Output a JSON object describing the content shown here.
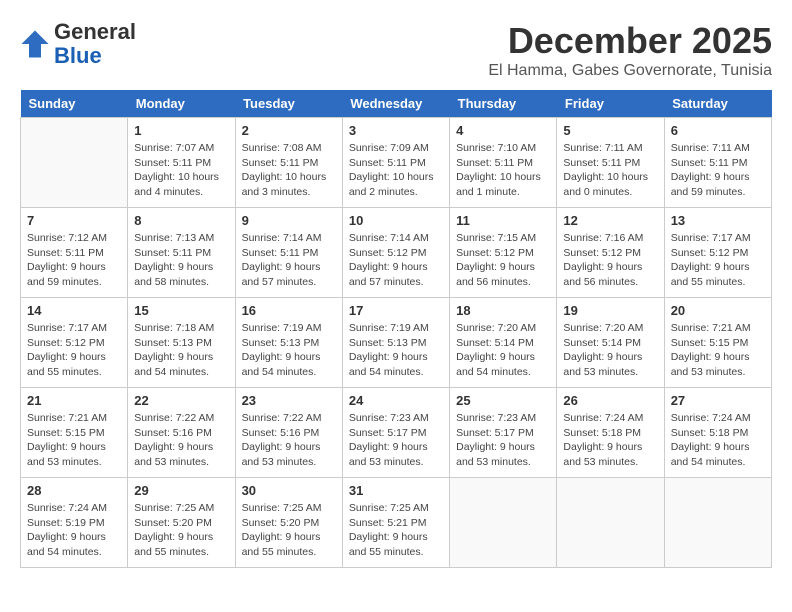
{
  "logo": {
    "line1": "General",
    "line2": "Blue"
  },
  "title": "December 2025",
  "subtitle": "El Hamma, Gabes Governorate, Tunisia",
  "days_header": [
    "Sunday",
    "Monday",
    "Tuesday",
    "Wednesday",
    "Thursday",
    "Friday",
    "Saturday"
  ],
  "weeks": [
    [
      {
        "num": "",
        "sunrise": "",
        "sunset": "",
        "daylight": ""
      },
      {
        "num": "1",
        "sunrise": "Sunrise: 7:07 AM",
        "sunset": "Sunset: 5:11 PM",
        "daylight": "Daylight: 10 hours and 4 minutes."
      },
      {
        "num": "2",
        "sunrise": "Sunrise: 7:08 AM",
        "sunset": "Sunset: 5:11 PM",
        "daylight": "Daylight: 10 hours and 3 minutes."
      },
      {
        "num": "3",
        "sunrise": "Sunrise: 7:09 AM",
        "sunset": "Sunset: 5:11 PM",
        "daylight": "Daylight: 10 hours and 2 minutes."
      },
      {
        "num": "4",
        "sunrise": "Sunrise: 7:10 AM",
        "sunset": "Sunset: 5:11 PM",
        "daylight": "Daylight: 10 hours and 1 minute."
      },
      {
        "num": "5",
        "sunrise": "Sunrise: 7:11 AM",
        "sunset": "Sunset: 5:11 PM",
        "daylight": "Daylight: 10 hours and 0 minutes."
      },
      {
        "num": "6",
        "sunrise": "Sunrise: 7:11 AM",
        "sunset": "Sunset: 5:11 PM",
        "daylight": "Daylight: 9 hours and 59 minutes."
      }
    ],
    [
      {
        "num": "7",
        "sunrise": "Sunrise: 7:12 AM",
        "sunset": "Sunset: 5:11 PM",
        "daylight": "Daylight: 9 hours and 59 minutes."
      },
      {
        "num": "8",
        "sunrise": "Sunrise: 7:13 AM",
        "sunset": "Sunset: 5:11 PM",
        "daylight": "Daylight: 9 hours and 58 minutes."
      },
      {
        "num": "9",
        "sunrise": "Sunrise: 7:14 AM",
        "sunset": "Sunset: 5:11 PM",
        "daylight": "Daylight: 9 hours and 57 minutes."
      },
      {
        "num": "10",
        "sunrise": "Sunrise: 7:14 AM",
        "sunset": "Sunset: 5:12 PM",
        "daylight": "Daylight: 9 hours and 57 minutes."
      },
      {
        "num": "11",
        "sunrise": "Sunrise: 7:15 AM",
        "sunset": "Sunset: 5:12 PM",
        "daylight": "Daylight: 9 hours and 56 minutes."
      },
      {
        "num": "12",
        "sunrise": "Sunrise: 7:16 AM",
        "sunset": "Sunset: 5:12 PM",
        "daylight": "Daylight: 9 hours and 56 minutes."
      },
      {
        "num": "13",
        "sunrise": "Sunrise: 7:17 AM",
        "sunset": "Sunset: 5:12 PM",
        "daylight": "Daylight: 9 hours and 55 minutes."
      }
    ],
    [
      {
        "num": "14",
        "sunrise": "Sunrise: 7:17 AM",
        "sunset": "Sunset: 5:12 PM",
        "daylight": "Daylight: 9 hours and 55 minutes."
      },
      {
        "num": "15",
        "sunrise": "Sunrise: 7:18 AM",
        "sunset": "Sunset: 5:13 PM",
        "daylight": "Daylight: 9 hours and 54 minutes."
      },
      {
        "num": "16",
        "sunrise": "Sunrise: 7:19 AM",
        "sunset": "Sunset: 5:13 PM",
        "daylight": "Daylight: 9 hours and 54 minutes."
      },
      {
        "num": "17",
        "sunrise": "Sunrise: 7:19 AM",
        "sunset": "Sunset: 5:13 PM",
        "daylight": "Daylight: 9 hours and 54 minutes."
      },
      {
        "num": "18",
        "sunrise": "Sunrise: 7:20 AM",
        "sunset": "Sunset: 5:14 PM",
        "daylight": "Daylight: 9 hours and 54 minutes."
      },
      {
        "num": "19",
        "sunrise": "Sunrise: 7:20 AM",
        "sunset": "Sunset: 5:14 PM",
        "daylight": "Daylight: 9 hours and 53 minutes."
      },
      {
        "num": "20",
        "sunrise": "Sunrise: 7:21 AM",
        "sunset": "Sunset: 5:15 PM",
        "daylight": "Daylight: 9 hours and 53 minutes."
      }
    ],
    [
      {
        "num": "21",
        "sunrise": "Sunrise: 7:21 AM",
        "sunset": "Sunset: 5:15 PM",
        "daylight": "Daylight: 9 hours and 53 minutes."
      },
      {
        "num": "22",
        "sunrise": "Sunrise: 7:22 AM",
        "sunset": "Sunset: 5:16 PM",
        "daylight": "Daylight: 9 hours and 53 minutes."
      },
      {
        "num": "23",
        "sunrise": "Sunrise: 7:22 AM",
        "sunset": "Sunset: 5:16 PM",
        "daylight": "Daylight: 9 hours and 53 minutes."
      },
      {
        "num": "24",
        "sunrise": "Sunrise: 7:23 AM",
        "sunset": "Sunset: 5:17 PM",
        "daylight": "Daylight: 9 hours and 53 minutes."
      },
      {
        "num": "25",
        "sunrise": "Sunrise: 7:23 AM",
        "sunset": "Sunset: 5:17 PM",
        "daylight": "Daylight: 9 hours and 53 minutes."
      },
      {
        "num": "26",
        "sunrise": "Sunrise: 7:24 AM",
        "sunset": "Sunset: 5:18 PM",
        "daylight": "Daylight: 9 hours and 53 minutes."
      },
      {
        "num": "27",
        "sunrise": "Sunrise: 7:24 AM",
        "sunset": "Sunset: 5:18 PM",
        "daylight": "Daylight: 9 hours and 54 minutes."
      }
    ],
    [
      {
        "num": "28",
        "sunrise": "Sunrise: 7:24 AM",
        "sunset": "Sunset: 5:19 PM",
        "daylight": "Daylight: 9 hours and 54 minutes."
      },
      {
        "num": "29",
        "sunrise": "Sunrise: 7:25 AM",
        "sunset": "Sunset: 5:20 PM",
        "daylight": "Daylight: 9 hours and 55 minutes."
      },
      {
        "num": "30",
        "sunrise": "Sunrise: 7:25 AM",
        "sunset": "Sunset: 5:20 PM",
        "daylight": "Daylight: 9 hours and 55 minutes."
      },
      {
        "num": "31",
        "sunrise": "Sunrise: 7:25 AM",
        "sunset": "Sunset: 5:21 PM",
        "daylight": "Daylight: 9 hours and 55 minutes."
      },
      {
        "num": "",
        "sunrise": "",
        "sunset": "",
        "daylight": ""
      },
      {
        "num": "",
        "sunrise": "",
        "sunset": "",
        "daylight": ""
      },
      {
        "num": "",
        "sunrise": "",
        "sunset": "",
        "daylight": ""
      }
    ]
  ]
}
